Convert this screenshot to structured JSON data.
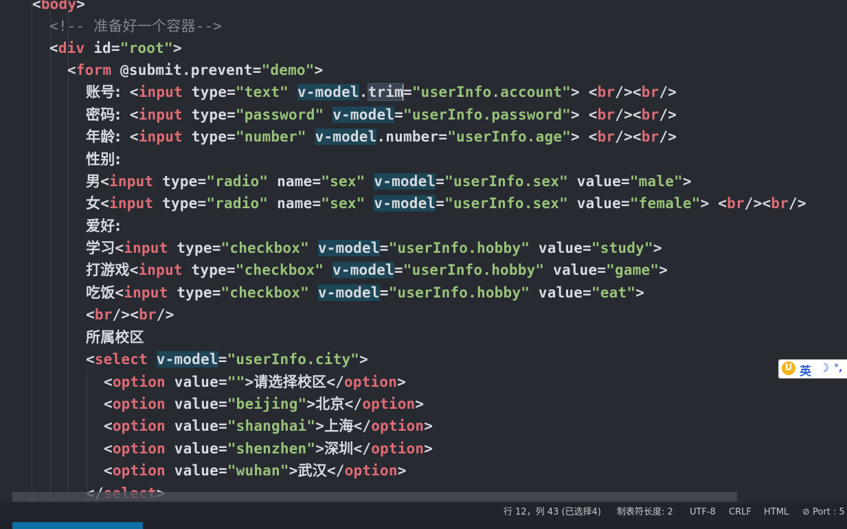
{
  "editor": {
    "lines": [
      {
        "id": "l0",
        "segments": [
          {
            "t": "<",
            "c": "punc"
          },
          {
            "t": "body",
            "c": "tag"
          },
          {
            "t": ">",
            "c": "punc"
          }
        ]
      },
      {
        "id": "l1",
        "segments": [
          {
            "t": "<!-- ",
            "c": "cmt"
          },
          {
            "t": "准备好一个容器",
            "c": "cmt"
          },
          {
            "t": "-->",
            "c": "cmt"
          }
        ]
      },
      {
        "id": "l2",
        "segments": [
          {
            "t": "<",
            "c": "punc"
          },
          {
            "t": "div",
            "c": "tag"
          },
          {
            "t": " id",
            "c": "attr"
          },
          {
            "t": "=",
            "c": "punc"
          },
          {
            "t": "\"root\"",
            "c": "str"
          },
          {
            "t": ">",
            "c": "punc"
          }
        ]
      },
      {
        "id": "l3",
        "segments": [
          {
            "t": "<",
            "c": "punc"
          },
          {
            "t": "form",
            "c": "tag"
          },
          {
            "t": " @submit.prevent",
            "c": "attr"
          },
          {
            "t": "=",
            "c": "punc"
          },
          {
            "t": "\"demo\"",
            "c": "str"
          },
          {
            "t": ">",
            "c": "punc"
          }
        ]
      },
      {
        "id": "l4",
        "segments": [
          {
            "t": "账号:",
            "c": "cn"
          },
          {
            "t": " <",
            "c": "punc"
          },
          {
            "t": "input",
            "c": "tag"
          },
          {
            "t": " type",
            "c": "attr"
          },
          {
            "t": "=",
            "c": "punc"
          },
          {
            "t": "\"text\"",
            "c": "str"
          },
          {
            "t": " ",
            "c": "punc"
          },
          {
            "t": "v-model",
            "c": "attr vm"
          },
          {
            "t": ".",
            "c": "punc"
          },
          {
            "t": "trim",
            "c": "attr tr"
          },
          {
            "t": "=",
            "c": "punc"
          },
          {
            "t": "\"userInfo.account\"",
            "c": "str"
          },
          {
            "t": "> <",
            "c": "punc"
          },
          {
            "t": "br",
            "c": "tag"
          },
          {
            "t": "/><",
            "c": "punc"
          },
          {
            "t": "br",
            "c": "tag"
          },
          {
            "t": "/>",
            "c": "punc"
          }
        ]
      },
      {
        "id": "l5",
        "segments": [
          {
            "t": "密码:",
            "c": "cn"
          },
          {
            "t": " <",
            "c": "punc"
          },
          {
            "t": "input",
            "c": "tag"
          },
          {
            "t": " type",
            "c": "attr"
          },
          {
            "t": "=",
            "c": "punc"
          },
          {
            "t": "\"password\"",
            "c": "str"
          },
          {
            "t": " ",
            "c": "punc"
          },
          {
            "t": "v-model",
            "c": "attr vm"
          },
          {
            "t": "=",
            "c": "punc"
          },
          {
            "t": "\"userInfo.password\"",
            "c": "str"
          },
          {
            "t": "> <",
            "c": "punc"
          },
          {
            "t": "br",
            "c": "tag"
          },
          {
            "t": "/><",
            "c": "punc"
          },
          {
            "t": "br",
            "c": "tag"
          },
          {
            "t": "/>",
            "c": "punc"
          }
        ]
      },
      {
        "id": "l6",
        "segments": [
          {
            "t": "年龄:",
            "c": "cn"
          },
          {
            "t": " <",
            "c": "punc"
          },
          {
            "t": "input",
            "c": "tag"
          },
          {
            "t": " type",
            "c": "attr"
          },
          {
            "t": "=",
            "c": "punc"
          },
          {
            "t": "\"number\"",
            "c": "str"
          },
          {
            "t": " ",
            "c": "punc"
          },
          {
            "t": "v-model",
            "c": "attr vm"
          },
          {
            "t": ".number",
            "c": "attr"
          },
          {
            "t": "=",
            "c": "punc"
          },
          {
            "t": "\"userInfo.age\"",
            "c": "str"
          },
          {
            "t": "> <",
            "c": "punc"
          },
          {
            "t": "br",
            "c": "tag"
          },
          {
            "t": "/><",
            "c": "punc"
          },
          {
            "t": "br",
            "c": "tag"
          },
          {
            "t": "/>",
            "c": "punc"
          }
        ]
      },
      {
        "id": "l7",
        "segments": [
          {
            "t": "性别:",
            "c": "cn"
          }
        ]
      },
      {
        "id": "l8",
        "segments": [
          {
            "t": "男",
            "c": "cn"
          },
          {
            "t": "<",
            "c": "punc"
          },
          {
            "t": "input",
            "c": "tag"
          },
          {
            "t": " type",
            "c": "attr"
          },
          {
            "t": "=",
            "c": "punc"
          },
          {
            "t": "\"radio\"",
            "c": "str"
          },
          {
            "t": " name",
            "c": "attr"
          },
          {
            "t": "=",
            "c": "punc"
          },
          {
            "t": "\"sex\"",
            "c": "str"
          },
          {
            "t": " ",
            "c": "punc"
          },
          {
            "t": "v-model",
            "c": "attr vm"
          },
          {
            "t": "=",
            "c": "punc"
          },
          {
            "t": "\"userInfo.sex\"",
            "c": "str"
          },
          {
            "t": " value",
            "c": "attr"
          },
          {
            "t": "=",
            "c": "punc"
          },
          {
            "t": "\"male\"",
            "c": "str"
          },
          {
            "t": ">",
            "c": "punc"
          }
        ]
      },
      {
        "id": "l9",
        "segments": [
          {
            "t": "女",
            "c": "cn"
          },
          {
            "t": "<",
            "c": "punc"
          },
          {
            "t": "input",
            "c": "tag"
          },
          {
            "t": " type",
            "c": "attr"
          },
          {
            "t": "=",
            "c": "punc"
          },
          {
            "t": "\"radio\"",
            "c": "str"
          },
          {
            "t": " name",
            "c": "attr"
          },
          {
            "t": "=",
            "c": "punc"
          },
          {
            "t": "\"sex\"",
            "c": "str"
          },
          {
            "t": " ",
            "c": "punc"
          },
          {
            "t": "v-model",
            "c": "attr vm"
          },
          {
            "t": "=",
            "c": "punc"
          },
          {
            "t": "\"userInfo.sex\"",
            "c": "str"
          },
          {
            "t": " value",
            "c": "attr"
          },
          {
            "t": "=",
            "c": "punc"
          },
          {
            "t": "\"female\"",
            "c": "str"
          },
          {
            "t": "> <",
            "c": "punc"
          },
          {
            "t": "br",
            "c": "tag"
          },
          {
            "t": "/><",
            "c": "punc"
          },
          {
            "t": "br",
            "c": "tag"
          },
          {
            "t": "/>",
            "c": "punc"
          }
        ]
      },
      {
        "id": "l10",
        "segments": [
          {
            "t": "爱好:",
            "c": "cn"
          }
        ]
      },
      {
        "id": "l11",
        "segments": [
          {
            "t": "学习",
            "c": "cn"
          },
          {
            "t": "<",
            "c": "punc"
          },
          {
            "t": "input",
            "c": "tag"
          },
          {
            "t": " type",
            "c": "attr"
          },
          {
            "t": "=",
            "c": "punc"
          },
          {
            "t": "\"checkbox\"",
            "c": "str"
          },
          {
            "t": " ",
            "c": "punc"
          },
          {
            "t": "v-model",
            "c": "attr vm"
          },
          {
            "t": "=",
            "c": "punc"
          },
          {
            "t": "\"userInfo.hobby\"",
            "c": "str"
          },
          {
            "t": " value",
            "c": "attr"
          },
          {
            "t": "=",
            "c": "punc"
          },
          {
            "t": "\"study\"",
            "c": "str"
          },
          {
            "t": ">",
            "c": "punc"
          }
        ]
      },
      {
        "id": "l12",
        "segments": [
          {
            "t": "打游戏",
            "c": "cn"
          },
          {
            "t": "<",
            "c": "punc"
          },
          {
            "t": "input",
            "c": "tag"
          },
          {
            "t": " type",
            "c": "attr"
          },
          {
            "t": "=",
            "c": "punc"
          },
          {
            "t": "\"checkbox\"",
            "c": "str"
          },
          {
            "t": " ",
            "c": "punc"
          },
          {
            "t": "v-model",
            "c": "attr vm"
          },
          {
            "t": "=",
            "c": "punc"
          },
          {
            "t": "\"userInfo.hobby\"",
            "c": "str"
          },
          {
            "t": " value",
            "c": "attr"
          },
          {
            "t": "=",
            "c": "punc"
          },
          {
            "t": "\"game\"",
            "c": "str"
          },
          {
            "t": ">",
            "c": "punc"
          }
        ]
      },
      {
        "id": "l13",
        "segments": [
          {
            "t": "吃饭",
            "c": "cn"
          },
          {
            "t": "<",
            "c": "punc"
          },
          {
            "t": "input",
            "c": "tag"
          },
          {
            "t": " type",
            "c": "attr"
          },
          {
            "t": "=",
            "c": "punc"
          },
          {
            "t": "\"checkbox\"",
            "c": "str"
          },
          {
            "t": " ",
            "c": "punc"
          },
          {
            "t": "v-model",
            "c": "attr vm"
          },
          {
            "t": "=",
            "c": "punc"
          },
          {
            "t": "\"userInfo.hobby\"",
            "c": "str"
          },
          {
            "t": " value",
            "c": "attr"
          },
          {
            "t": "=",
            "c": "punc"
          },
          {
            "t": "\"eat\"",
            "c": "str"
          },
          {
            "t": ">",
            "c": "punc"
          }
        ]
      },
      {
        "id": "l14",
        "segments": [
          {
            "t": "<",
            "c": "punc"
          },
          {
            "t": "br",
            "c": "tag"
          },
          {
            "t": "/><",
            "c": "punc"
          },
          {
            "t": "br",
            "c": "tag"
          },
          {
            "t": "/>",
            "c": "punc"
          }
        ]
      },
      {
        "id": "l15",
        "segments": [
          {
            "t": "所属校区",
            "c": "cn"
          }
        ]
      },
      {
        "id": "l16",
        "segments": [
          {
            "t": "<",
            "c": "punc"
          },
          {
            "t": "select",
            "c": "tag"
          },
          {
            "t": " ",
            "c": "punc"
          },
          {
            "t": "v-model",
            "c": "attr vm"
          },
          {
            "t": "=",
            "c": "punc"
          },
          {
            "t": "\"userInfo.city\"",
            "c": "str"
          },
          {
            "t": ">",
            "c": "punc"
          }
        ]
      },
      {
        "id": "l17",
        "segments": [
          {
            "t": "<",
            "c": "punc"
          },
          {
            "t": "option",
            "c": "tag"
          },
          {
            "t": " value",
            "c": "attr"
          },
          {
            "t": "=",
            "c": "punc"
          },
          {
            "t": "\"\"",
            "c": "str"
          },
          {
            "t": ">",
            "c": "punc"
          },
          {
            "t": "请选择校区",
            "c": "cn"
          },
          {
            "t": "</",
            "c": "punc"
          },
          {
            "t": "option",
            "c": "tag"
          },
          {
            "t": ">",
            "c": "punc"
          }
        ]
      },
      {
        "id": "l18",
        "segments": [
          {
            "t": "<",
            "c": "punc"
          },
          {
            "t": "option",
            "c": "tag"
          },
          {
            "t": " value",
            "c": "attr"
          },
          {
            "t": "=",
            "c": "punc"
          },
          {
            "t": "\"beijing\"",
            "c": "str"
          },
          {
            "t": ">",
            "c": "punc"
          },
          {
            "t": "北京",
            "c": "cn"
          },
          {
            "t": "</",
            "c": "punc"
          },
          {
            "t": "option",
            "c": "tag"
          },
          {
            "t": ">",
            "c": "punc"
          }
        ]
      },
      {
        "id": "l19",
        "segments": [
          {
            "t": "<",
            "c": "punc"
          },
          {
            "t": "option",
            "c": "tag"
          },
          {
            "t": " value",
            "c": "attr"
          },
          {
            "t": "=",
            "c": "punc"
          },
          {
            "t": "\"shanghai\"",
            "c": "str"
          },
          {
            "t": ">",
            "c": "punc"
          },
          {
            "t": "上海",
            "c": "cn"
          },
          {
            "t": "</",
            "c": "punc"
          },
          {
            "t": "option",
            "c": "tag"
          },
          {
            "t": ">",
            "c": "punc"
          }
        ]
      },
      {
        "id": "l20",
        "segments": [
          {
            "t": "<",
            "c": "punc"
          },
          {
            "t": "option",
            "c": "tag"
          },
          {
            "t": " value",
            "c": "attr"
          },
          {
            "t": "=",
            "c": "punc"
          },
          {
            "t": "\"shenzhen\"",
            "c": "str"
          },
          {
            "t": ">",
            "c": "punc"
          },
          {
            "t": "深圳",
            "c": "cn"
          },
          {
            "t": "</",
            "c": "punc"
          },
          {
            "t": "option",
            "c": "tag"
          },
          {
            "t": ">",
            "c": "punc"
          }
        ]
      },
      {
        "id": "l21",
        "segments": [
          {
            "t": "<",
            "c": "punc"
          },
          {
            "t": "option",
            "c": "tag"
          },
          {
            "t": " value",
            "c": "attr"
          },
          {
            "t": "=",
            "c": "punc"
          },
          {
            "t": "\"wuhan\"",
            "c": "str"
          },
          {
            "t": ">",
            "c": "punc"
          },
          {
            "t": "武汉",
            "c": "cn"
          },
          {
            "t": "</",
            "c": "punc"
          },
          {
            "t": "option",
            "c": "tag"
          },
          {
            "t": ">",
            "c": "punc"
          }
        ]
      },
      {
        "id": "l22",
        "segments": [
          {
            "t": "</",
            "c": "punc"
          },
          {
            "t": "select",
            "c": "tag"
          },
          {
            "t": ">",
            "c": "punc"
          }
        ]
      }
    ]
  },
  "statusbar": {
    "position": "行 12，列 43 (已选择4)",
    "tab_size": "制表符长度: 2",
    "encoding": "UTF-8",
    "eol": "CRLF",
    "language": "HTML",
    "port": "⊘ Port : 5"
  },
  "ime": {
    "mode": "英",
    "moon": "☽",
    "punct": "°,"
  },
  "colors": {
    "editor_bg": "#272a31",
    "tag": "#e06c75",
    "string": "#98c379",
    "vmodel_highlight": "#1d4657"
  }
}
